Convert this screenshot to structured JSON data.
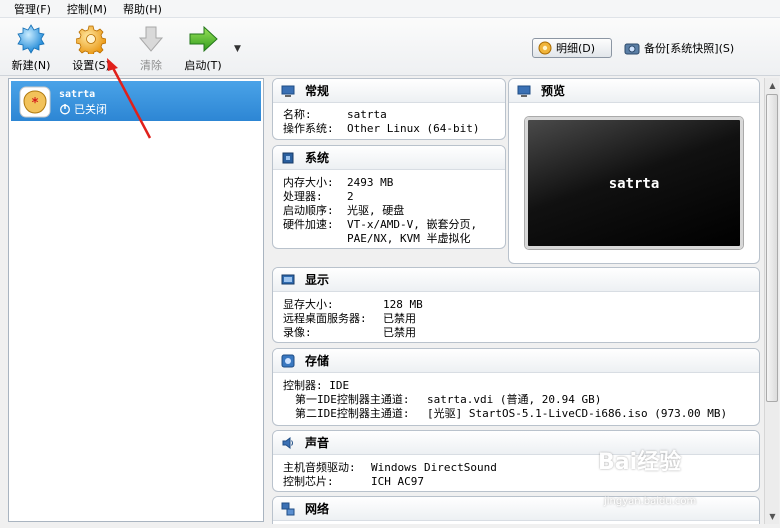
{
  "menu": [
    {
      "label": "管理(F)"
    },
    {
      "label": "控制(M)"
    },
    {
      "label": "帮助(H)"
    }
  ],
  "toolbar": {
    "new_label": "新建(N)",
    "settings_label": "设置(S)",
    "discard_label": "清除",
    "start_label": "启动(T)",
    "details_label": "明细(D)",
    "snapshots_label": "备份[系统快照](S)"
  },
  "vm": {
    "name": "satrta",
    "status": "已关闭"
  },
  "general": {
    "title": "常规",
    "name_key": "名称:",
    "name_val": "satrta",
    "os_key": "操作系统:",
    "os_val": "Other Linux (64-bit)"
  },
  "system": {
    "title": "系统",
    "mem_key": "内存大小:",
    "mem_val": "2493 MB",
    "cpu_key": "处理器:",
    "cpu_val": "2",
    "boot_key": "启动顺序:",
    "boot_val": "光驱, 硬盘",
    "accel_key": "硬件加速:",
    "accel_val1": "VT-x/AMD-V, 嵌套分页,",
    "accel_val2": "PAE/NX, KVM 半虚拟化"
  },
  "preview": {
    "title": "预览",
    "screen_text": "satrta"
  },
  "display": {
    "title": "显示",
    "vram_key": "显存大小:",
    "vram_val": "128 MB",
    "rdp_key": "远程桌面服务器:",
    "rdp_val": "已禁用",
    "rec_key": "录像:",
    "rec_val": "已禁用"
  },
  "storage": {
    "title": "存储",
    "ctrl": "控制器: IDE",
    "p1_key": "第一IDE控制器主通道:",
    "p1_val": "satrta.vdi (普通, 20.94 GB)",
    "p2_key": "第二IDE控制器主通道:",
    "p2_val": "[光驱] StartOS-5.1-LiveCD-i686.iso (973.00 MB)"
  },
  "audio": {
    "title": "声音",
    "driver_key": "主机音频驱动:",
    "driver_val": "Windows DirectSound",
    "chip_key": "控制芯片:",
    "chip_val": "ICH AC97"
  },
  "network": {
    "title": "网络"
  },
  "watermark": {
    "brand": "Bai经验",
    "url": "jingyan.baidu.com"
  },
  "colors": {
    "selection": "#2d86d4",
    "annotation": "#e0201b"
  }
}
